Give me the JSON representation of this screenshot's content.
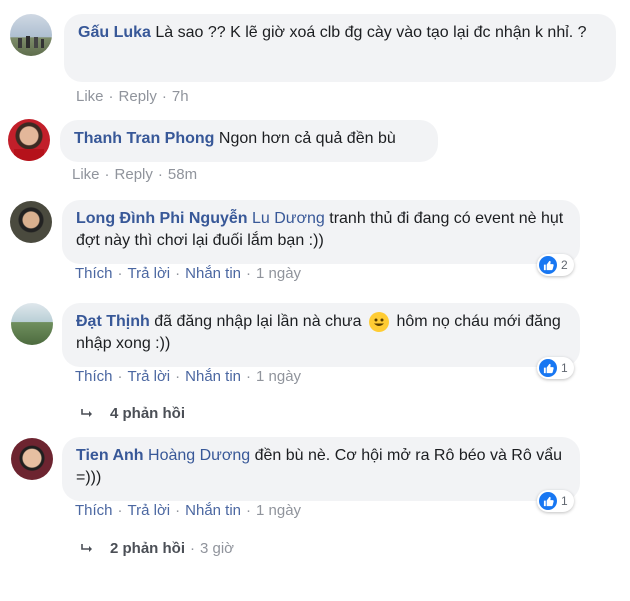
{
  "comments": [
    {
      "author": "Gấu Luka",
      "text": "Là sao ?? K lẽ giờ xoá clb đg cày vào tạo lại đc nhận k nhỉ. ?",
      "actions": {
        "like": "Like",
        "reply": "Reply",
        "time": "7h"
      }
    },
    {
      "author": "Thanh Tran Phong",
      "text": "Ngon hơn cả quả đền bù",
      "actions": {
        "like": "Like",
        "reply": "Reply",
        "time": "58m"
      }
    },
    {
      "author": "Long Đình Phi Nguyễn",
      "mention": "Lu Dương",
      "text": "tranh thủ đi đang có event nè hụt đợt này thì chơi lại đuối lắm bạn :))",
      "actions": {
        "like": "Thích",
        "reply": "Trả lời",
        "message": "Nhắn tin",
        "time": "1 ngày"
      },
      "reactions": "2"
    },
    {
      "author": "Đạt Thịnh",
      "text_before": "đã đăng nhập lại lần nà chưa",
      "emoji": "grin-emoji",
      "text_after": "hôm nọ cháu mới đăng nhập xong :))",
      "actions": {
        "like": "Thích",
        "reply": "Trả lời",
        "message": "Nhắn tin",
        "time": "1 ngày"
      },
      "reactions": "1",
      "replies": {
        "label": "4 phản hồi"
      }
    },
    {
      "author": "Tien Anh",
      "mention": "Hoàng Dương",
      "text": "đền bù nè. Cơ hội mở ra Rô béo và Rô vẩu =)))",
      "actions": {
        "like": "Thích",
        "reply": "Trả lời",
        "message": "Nhắn tin",
        "time": "1 ngày"
      },
      "reactions": "1",
      "replies": {
        "label": "2 phản hồi",
        "time": "3 giờ"
      }
    }
  ],
  "colors": {
    "link": "#385898",
    "bubble": "#f2f3f5",
    "meta": "#90949c",
    "like_blue": "#1877f2"
  }
}
